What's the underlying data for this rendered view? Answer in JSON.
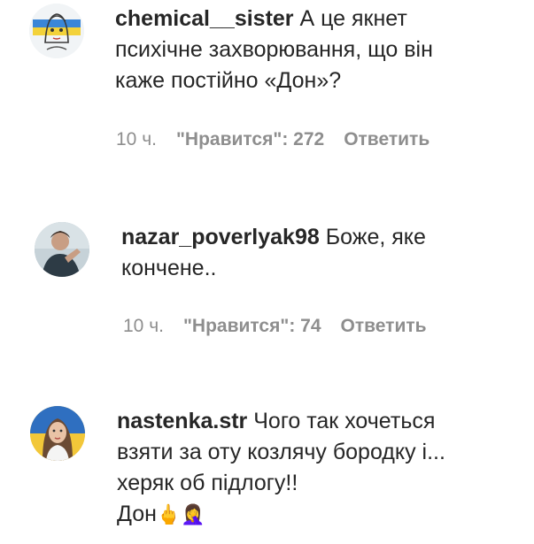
{
  "comments": [
    {
      "username": "chemical__sister",
      "text_lines": [
        "А це якнет",
        "психічне захворювання, що він",
        "каже постійно «Дон»?"
      ],
      "time": "10 ч.",
      "likes_label": "\"Нравится\": 272",
      "reply_label": "Ответить",
      "avatar_icon": "avatar-illustration-icon"
    },
    {
      "username": "nazar_poverlyak98",
      "text_lines": [
        "Боже, яке",
        "кончене.."
      ],
      "time": "10 ч.",
      "likes_label": "\"Нравится\": 74",
      "reply_label": "Ответить",
      "avatar_icon": "avatar-photo-icon"
    },
    {
      "username": "nastenka.str",
      "text_lines": [
        "Чого так хочеться",
        "взяти за оту козлячу бородку і...",
        "херяк об підлогу!!",
        "Дон"
      ],
      "emoji": "🖕🤦‍♀️",
      "avatar_icon": "avatar-photo-icon"
    }
  ]
}
